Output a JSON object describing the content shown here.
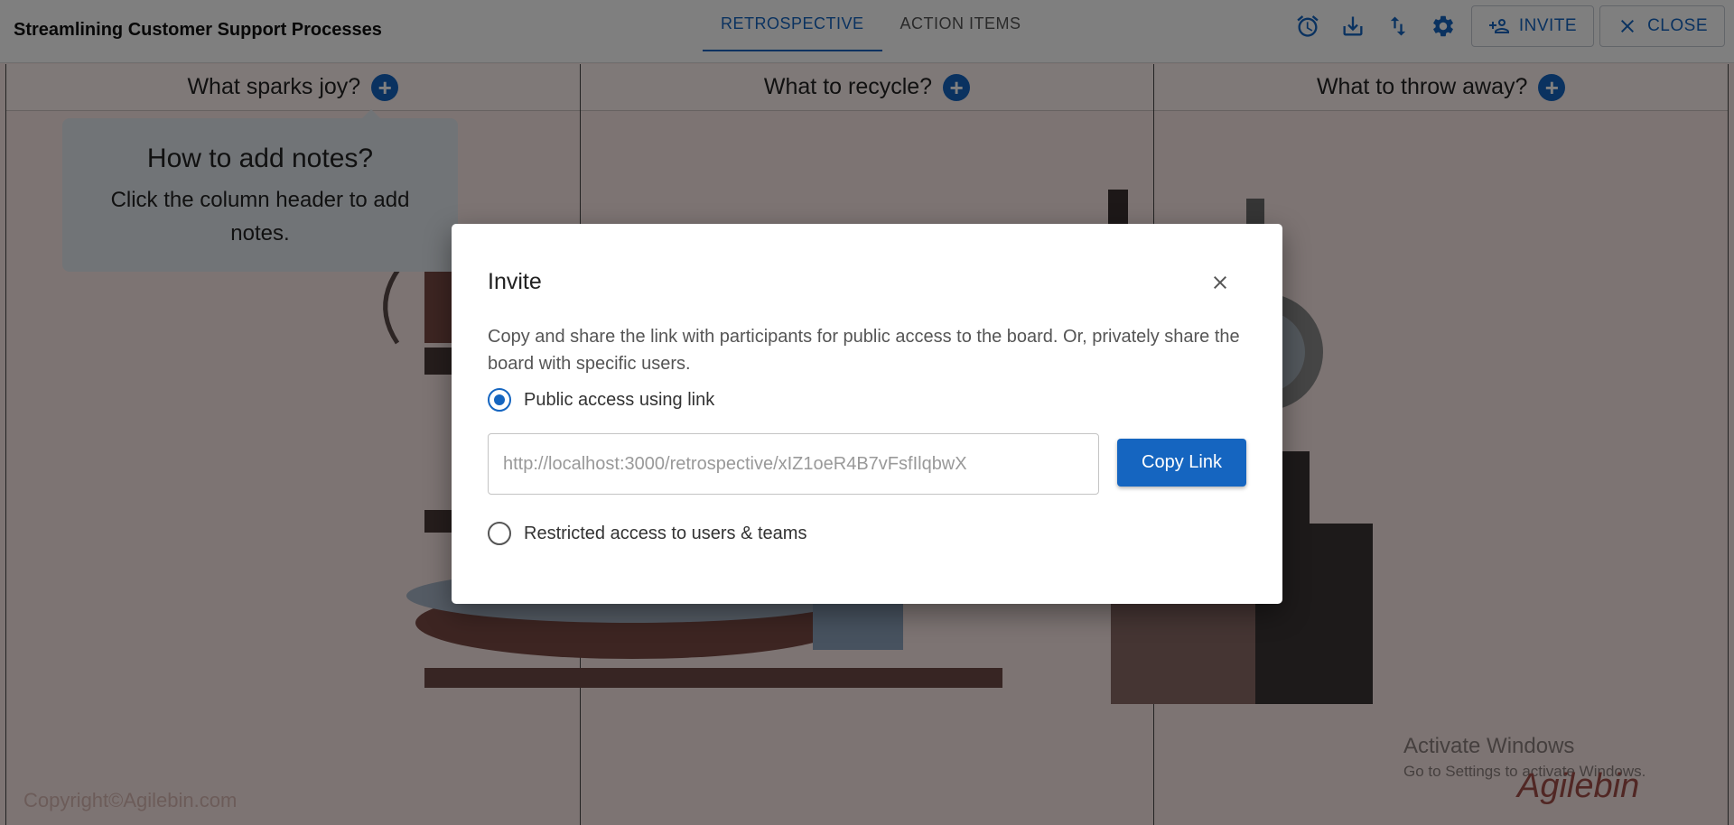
{
  "header": {
    "board_title": "Streamlining Customer Support Processes",
    "tabs": [
      {
        "label": "RETROSPECTIVE",
        "active": true
      },
      {
        "label": "ACTION ITEMS",
        "active": false
      }
    ],
    "icons": [
      "alarm-icon",
      "download-icon",
      "sort-icon",
      "settings-icon"
    ],
    "invite_label": "INVITE",
    "close_label": "CLOSE"
  },
  "columns": [
    {
      "title": "What sparks joy?"
    },
    {
      "title": "What to recycle?"
    },
    {
      "title": "What to throw away?"
    }
  ],
  "hint": {
    "title": "How to add notes?",
    "body": "Click the column header to add notes."
  },
  "footer": {
    "copyright": "Copyright©Agilebin.com",
    "activate_title": "Activate Windows",
    "activate_sub": "Go to Settings to activate Windows.",
    "logo_text": "Agilebin"
  },
  "dialog": {
    "title": "Invite",
    "description": "Copy and share the link with participants for public access to the board. Or, privately share the board with specific users.",
    "options": [
      {
        "label": "Public access using link",
        "checked": true
      },
      {
        "label": "Restricted access to users & teams",
        "checked": false
      }
    ],
    "link_value": "http://localhost:3000/retrospective/xIZ1oeR4B7vFsfIlqbwX",
    "copy_label": "Copy Link"
  },
  "colors": {
    "accent": "#1565c0",
    "board_bg": "#fbe9e7"
  }
}
